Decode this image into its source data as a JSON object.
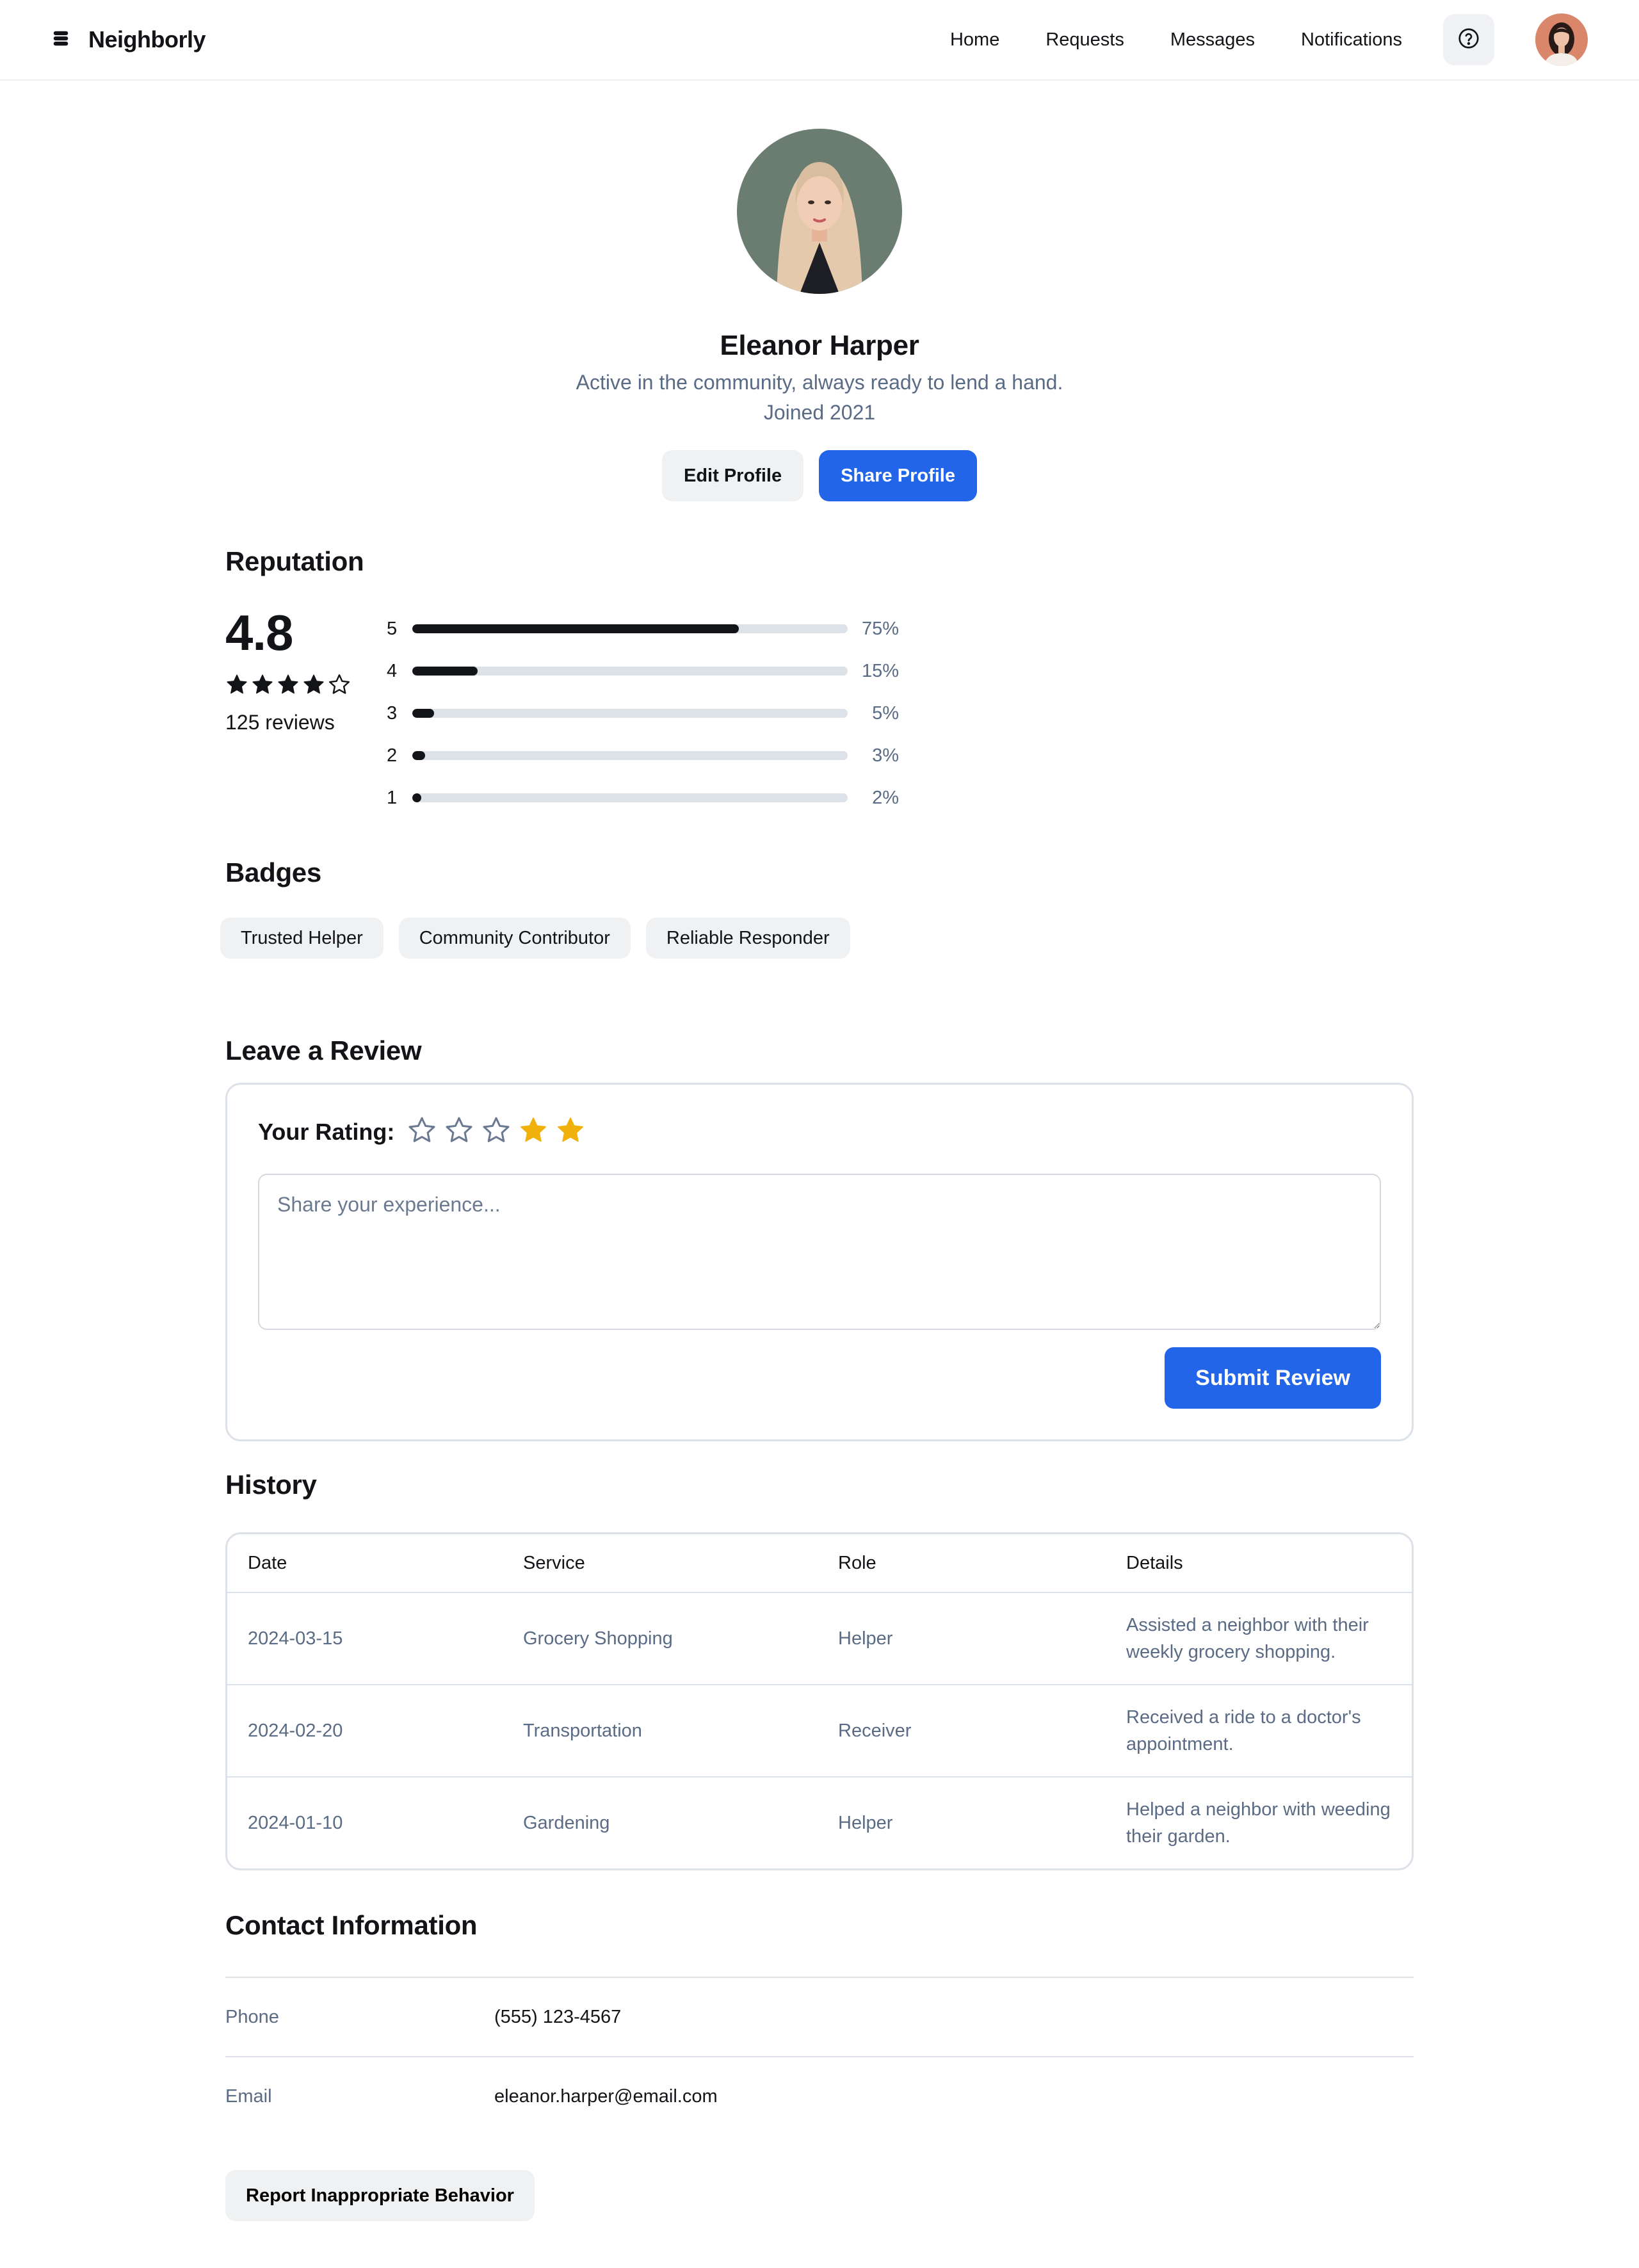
{
  "nav": {
    "brand": "Neighborly",
    "logo_icon": "stack-icon",
    "links": [
      "Home",
      "Requests",
      "Messages",
      "Notifications"
    ],
    "help_icon": "help-circle-icon"
  },
  "profile": {
    "name": "Eleanor Harper",
    "bio": "Active in the community, always ready to lend a hand.",
    "joined": "Joined 2021",
    "edit_label": "Edit Profile",
    "share_label": "Share Profile"
  },
  "reputation": {
    "title": "Reputation",
    "score": "4.8",
    "stars_filled": 4,
    "reviews": "125 reviews",
    "distribution": [
      {
        "star": "5",
        "percent": 75,
        "label": "75%"
      },
      {
        "star": "4",
        "percent": 15,
        "label": "15%"
      },
      {
        "star": "3",
        "percent": 5,
        "label": "5%"
      },
      {
        "star": "2",
        "percent": 3,
        "label": "3%"
      },
      {
        "star": "1",
        "percent": 2,
        "label": "2%"
      }
    ]
  },
  "badges": {
    "title": "Badges",
    "items": [
      "Trusted Helper",
      "Community Contributor",
      "Reliable Responder"
    ]
  },
  "review": {
    "title": "Leave a Review",
    "rating_label": "Your Rating:",
    "rating_states": [
      false,
      false,
      false,
      true,
      true
    ],
    "placeholder": "Share your experience...",
    "submit_label": "Submit Review"
  },
  "history": {
    "title": "History",
    "headers": [
      "Date",
      "Service",
      "Role",
      "Details"
    ],
    "rows": [
      [
        "2024-03-15",
        "Grocery Shopping",
        "Helper",
        "Assisted a neighbor with their weekly grocery shopping."
      ],
      [
        "2024-02-20",
        "Transportation",
        "Receiver",
        "Received a ride to a doctor's appointment."
      ],
      [
        "2024-01-10",
        "Gardening",
        "Helper",
        "Helped a neighbor with weeding their garden."
      ]
    ]
  },
  "contact": {
    "title": "Contact Information",
    "phone_label": "Phone",
    "phone": "(555) 123-4567",
    "email_label": "Email",
    "email": "eleanor.harper@email.com"
  },
  "report_label": "Report Inappropriate Behavior",
  "colors": {
    "accent": "#2265e8",
    "star_gold": "#f0b10c",
    "text_muted": "#5a6b85",
    "border": "#dde2e8"
  }
}
